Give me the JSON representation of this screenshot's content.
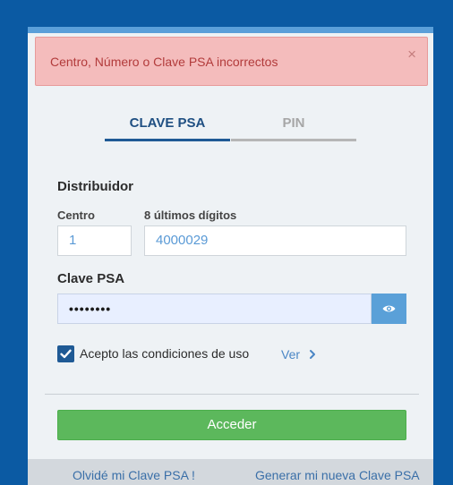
{
  "alert": {
    "message": "Centro, Número o Clave PSA incorrectos",
    "close": "×"
  },
  "tabs": [
    {
      "label": "CLAVE PSA",
      "active": true
    },
    {
      "label": "PIN",
      "active": false
    }
  ],
  "distribuidor": {
    "title": "Distribuidor",
    "centro_label": "Centro",
    "centro_value": "1",
    "digitos_label": "8 últimos dígitos",
    "digitos_value": "4000029"
  },
  "clave": {
    "title": "Clave PSA",
    "masked_value": "••••••••",
    "toggle_icon": "eye-icon"
  },
  "terms": {
    "checked": true,
    "label": "Acepto las condiciones de uso",
    "ver_link": "Ver"
  },
  "submit_label": "Acceder",
  "footer": {
    "forgot": "Olvidé mi Clave PSA !",
    "generate": "Generar mi nueva Clave PSA"
  },
  "colors": {
    "background": "#0b5aa3",
    "accent": "#1f5a95",
    "alert_bg": "#f4bcbc",
    "alert_text": "#b23b3b",
    "success": "#5cb85c",
    "eye_button": "#5aa0d8"
  }
}
